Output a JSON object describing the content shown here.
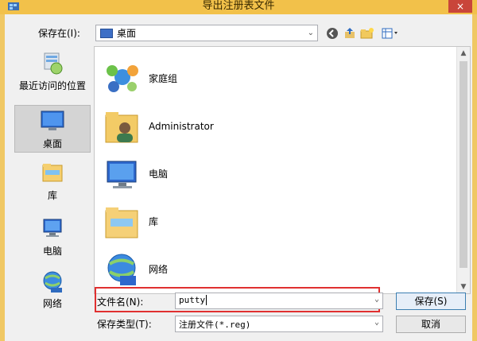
{
  "window": {
    "title": "导出注册表文件",
    "close": "×"
  },
  "save_in": {
    "label": "保存在(I):",
    "value": "桌面"
  },
  "toolbar": {
    "back": "●",
    "up": "⇧",
    "new_folder": "📁",
    "view": "▦▾"
  },
  "places": [
    {
      "label": "最近访问的位置"
    },
    {
      "label": "桌面"
    },
    {
      "label": "库"
    },
    {
      "label": "电脑"
    },
    {
      "label": "网络"
    }
  ],
  "files": [
    {
      "name": "家庭组",
      "icon": "homegroup-icon"
    },
    {
      "name": "Administrator",
      "icon": "user-folder-icon"
    },
    {
      "name": "电脑",
      "icon": "computer-icon"
    },
    {
      "name": "库",
      "icon": "library-icon"
    },
    {
      "name": "网络",
      "icon": "network-icon"
    }
  ],
  "filename": {
    "label": "文件名(N):",
    "value": "putty"
  },
  "filetype": {
    "label": "保存类型(T):",
    "value": "注册文件(*.reg)"
  },
  "buttons": {
    "save": "保存(S)",
    "cancel": "取消"
  }
}
